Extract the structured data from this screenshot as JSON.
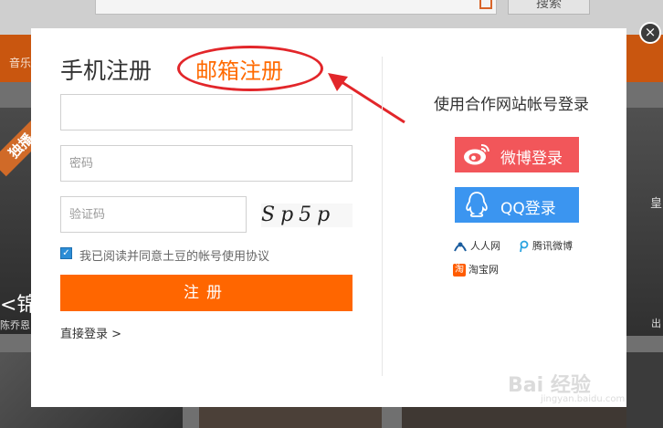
{
  "background": {
    "search_button": "搜索",
    "nav_left": "音乐",
    "ribbon": "独播",
    "poster_title": "<锦",
    "poster_sub": "陈乔恩",
    "right_text": "皇",
    "right_sub": "出"
  },
  "modal": {
    "title": "手机注册",
    "email_tab": "邮箱注册",
    "close_label": "×",
    "password_placeholder": "密码",
    "code_placeholder": "验证码",
    "captcha_text": "Sp5p",
    "agree_check": "✓",
    "agree_text": "我已阅读并同意土豆的帐号使用协议",
    "submit_label": "注册",
    "direct_login": "直接登录 >",
    "partner_title": "使用合作网站帐号登录",
    "weibo_label": "微博登录",
    "qq_label": "QQ登录",
    "renren_label": "人人网",
    "tencent_label": "腾讯微博",
    "taobao_icon": "淘",
    "taobao_label": "淘宝网"
  },
  "watermark": {
    "text": "Bai 经验",
    "sub": "jingyan.baidu.com"
  },
  "colors": {
    "accent_orange": "#ff6600",
    "weibo_red": "#f2565a",
    "qq_blue": "#3b95f0",
    "annotation_red": "#e2262a"
  }
}
